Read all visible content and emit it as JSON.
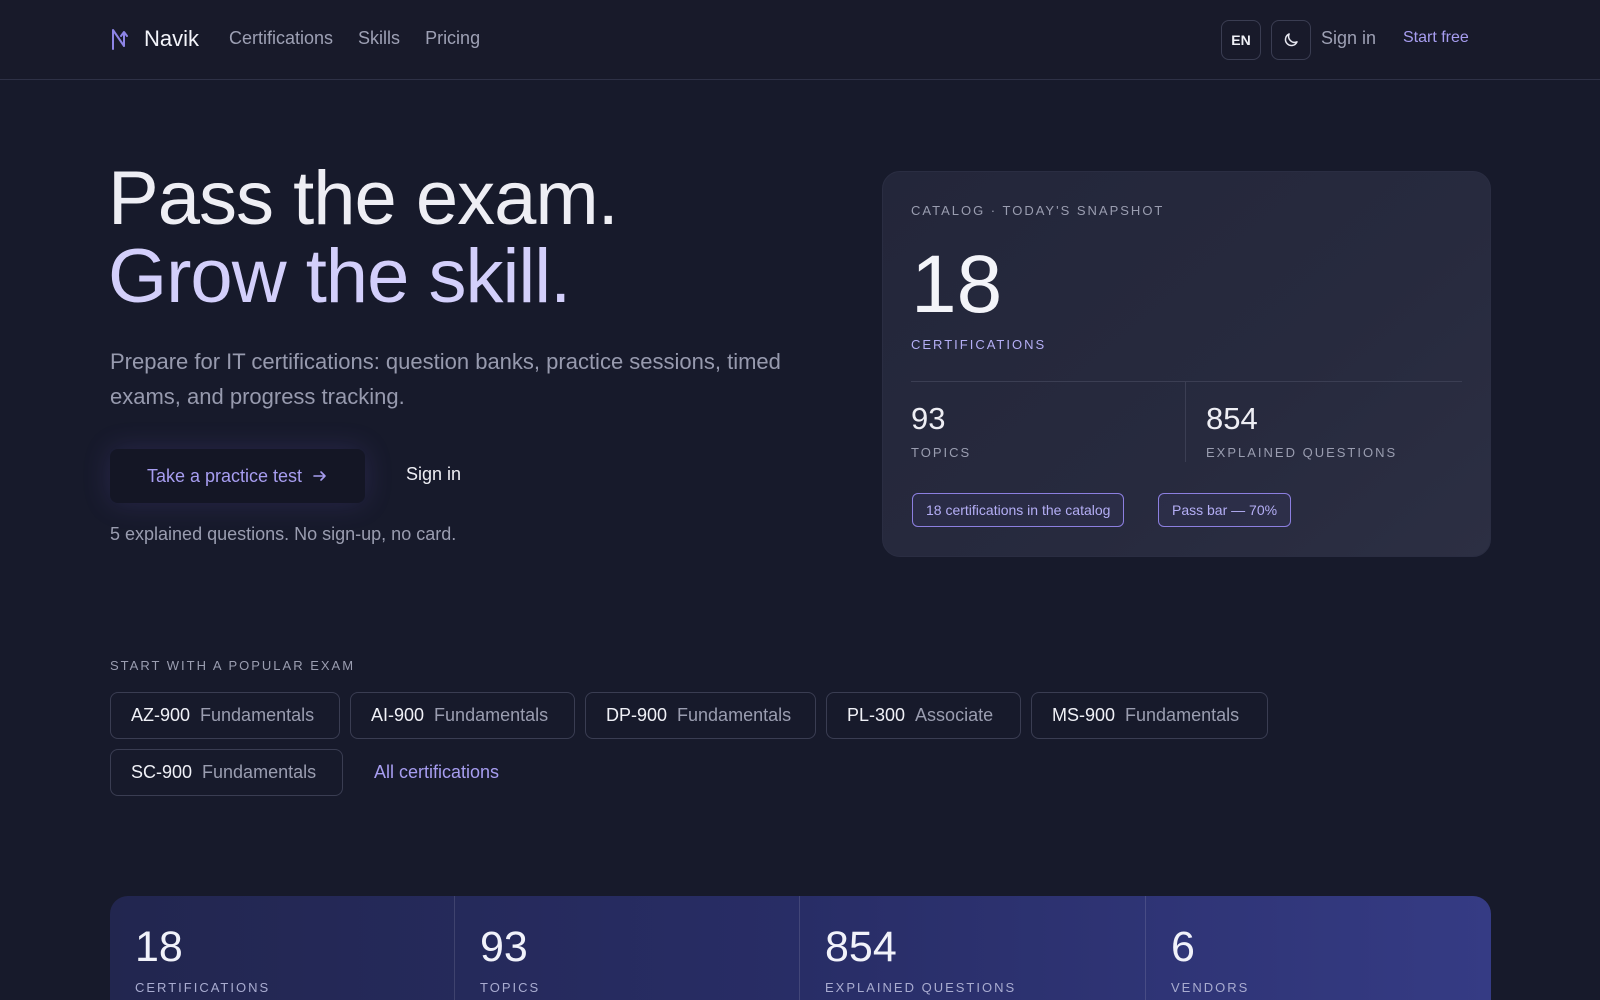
{
  "header": {
    "brand": "Navik",
    "nav": [
      "Certifications",
      "Skills",
      "Pricing"
    ],
    "lang": "EN",
    "sign_in": "Sign in",
    "start_free": "Start free"
  },
  "hero": {
    "title_line1": "Pass the exam.",
    "title_line2": "Grow the skill.",
    "subtitle": "Prepare for IT certifications: question banks, practice sessions, timed exams, and progress tracking.",
    "cta_primary": "Take a practice test",
    "cta_secondary": "Sign in",
    "note": "5 explained questions. No sign-up, no card."
  },
  "snapshot": {
    "kicker": "CATALOG · TODAY'S SNAPSHOT",
    "big_value": "18",
    "big_label": "CERTIFICATIONS",
    "stats": [
      {
        "value": "93",
        "label": "TOPICS"
      },
      {
        "value": "854",
        "label": "EXPLAINED QUESTIONS"
      }
    ],
    "chips": [
      "18 certifications in the catalog",
      "Pass bar — 70%"
    ]
  },
  "popular": {
    "label": "START WITH A POPULAR EXAM",
    "exams": [
      {
        "code": "AZ-900",
        "level": "Fundamentals"
      },
      {
        "code": "AI-900",
        "level": "Fundamentals"
      },
      {
        "code": "DP-900",
        "level": "Fundamentals"
      },
      {
        "code": "PL-300",
        "level": "Associate"
      },
      {
        "code": "MS-900",
        "level": "Fundamentals"
      },
      {
        "code": "SC-900",
        "level": "Fundamentals"
      }
    ],
    "all_link": "All certifications"
  },
  "band": [
    {
      "value": "18",
      "label": "CERTIFICATIONS"
    },
    {
      "value": "93",
      "label": "TOPICS"
    },
    {
      "value": "854",
      "label": "EXPLAINED QUESTIONS"
    },
    {
      "value": "6",
      "label": "VENDORS"
    }
  ],
  "colors": {
    "background": "#171a2b",
    "accent": "#a79df0",
    "accent_light": "#d3cffb"
  },
  "icons": [
    "navik-logo-icon",
    "moon-icon",
    "arrow-right-icon"
  ]
}
